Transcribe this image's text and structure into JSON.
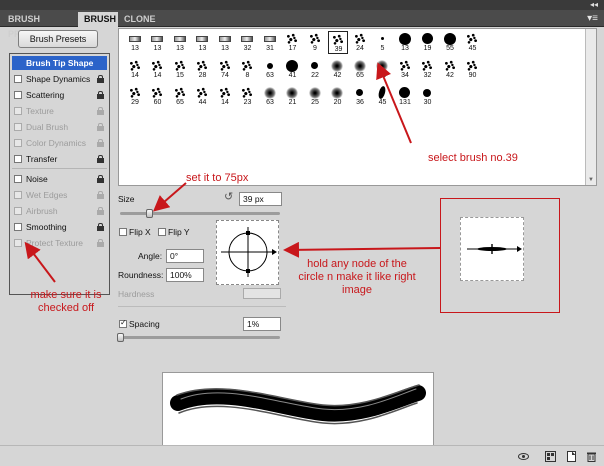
{
  "tabs": [
    {
      "label": "BRUSH PRESETS"
    },
    {
      "label": "BRUSH"
    },
    {
      "label": "CLONE SOURCE"
    }
  ],
  "presets_button": "Brush Presets",
  "sidebar": [
    {
      "label": "Brush Tip Shape",
      "selected": true
    },
    {
      "label": "Shape Dynamics",
      "enabled": true
    },
    {
      "label": "Scattering",
      "enabled": true
    },
    {
      "label": "Texture",
      "enabled": false
    },
    {
      "label": "Dual Brush",
      "enabled": false
    },
    {
      "label": "Color Dynamics",
      "enabled": false
    },
    {
      "label": "Transfer",
      "enabled": true
    },
    {
      "label": "Noise",
      "enabled": true
    },
    {
      "label": "Wet Edges",
      "enabled": false
    },
    {
      "label": "Airbrush",
      "enabled": false
    },
    {
      "label": "Smoothing",
      "enabled": true
    },
    {
      "label": "Protect Texture",
      "enabled": false
    }
  ],
  "brushes": {
    "row1": [
      "13",
      "13",
      "13",
      "13",
      "13",
      "32",
      "31",
      "17",
      "9",
      "39",
      "24",
      "5",
      "13",
      "19",
      "55",
      "45"
    ],
    "row2": [
      "14",
      "14",
      "15",
      "28",
      "74",
      "8",
      "63",
      "41",
      "22",
      "42",
      "65",
      "45",
      "34",
      "32",
      "42",
      "90"
    ],
    "row3": [
      "29",
      "60",
      "65",
      "44",
      "14",
      "23",
      "63",
      "21",
      "25",
      "20",
      "36",
      "45",
      "131",
      "30"
    ],
    "selected_index": 9
  },
  "size": {
    "label": "Size",
    "value": "39 px"
  },
  "flip_x": {
    "label": "Flip X"
  },
  "flip_y": {
    "label": "Flip Y"
  },
  "angle": {
    "label": "Angle:",
    "value": "0°"
  },
  "roundness": {
    "label": "Roundness:",
    "value": "100%"
  },
  "hardness": {
    "label": "Hardness"
  },
  "spacing": {
    "label": "Spacing",
    "value": "1%",
    "checked": true
  },
  "annotations": {
    "select_brush": "select brush no.39",
    "set_size": "set it to 75px",
    "hold_node_1": "hold any node of the",
    "hold_node_2": "circle n make it like right",
    "hold_node_3": "image",
    "checked_off_1": "make sure it is",
    "checked_off_2": "checked off"
  },
  "colors": {
    "annotation": "#c8171b",
    "selection": "#2b63c9"
  }
}
